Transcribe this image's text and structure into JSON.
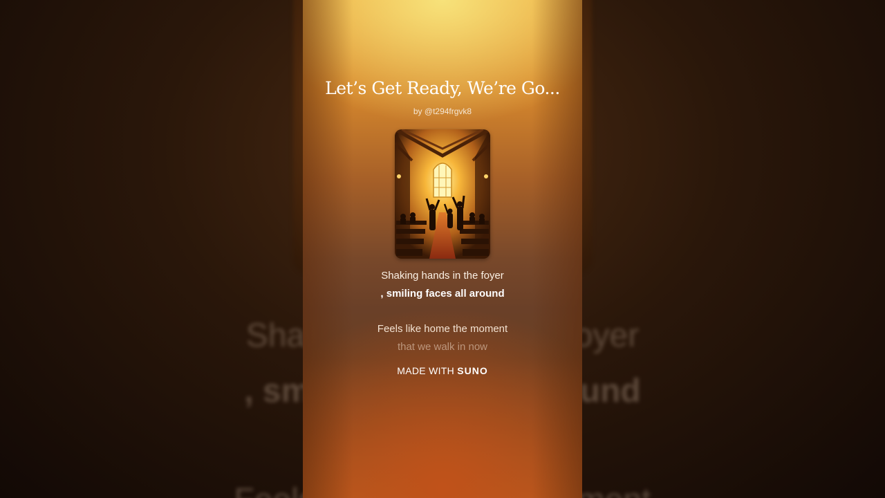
{
  "song": {
    "title": "Let’s Get Ready, We’re Go...",
    "byline": "by @t294frgvk8"
  },
  "lyrics": {
    "line1": "Shaking hands in the foyer",
    "line2": ", smiling faces all around",
    "line3": "Feels like home the moment",
    "line4": "that we walk in now"
  },
  "background_lyrics": {
    "line1": "Shaking hands in the foyer",
    "line2": ", smiling faces all around",
    "line3": "Feels like home the moment"
  },
  "footer": {
    "made_with": "MADE WITH",
    "brand": "SUNO"
  },
  "colors": {
    "card_top": "#eca63a",
    "card_bottom": "#b25a1e",
    "background": "#120905"
  },
  "icons": {
    "cover_art": "church-worship-cover"
  }
}
